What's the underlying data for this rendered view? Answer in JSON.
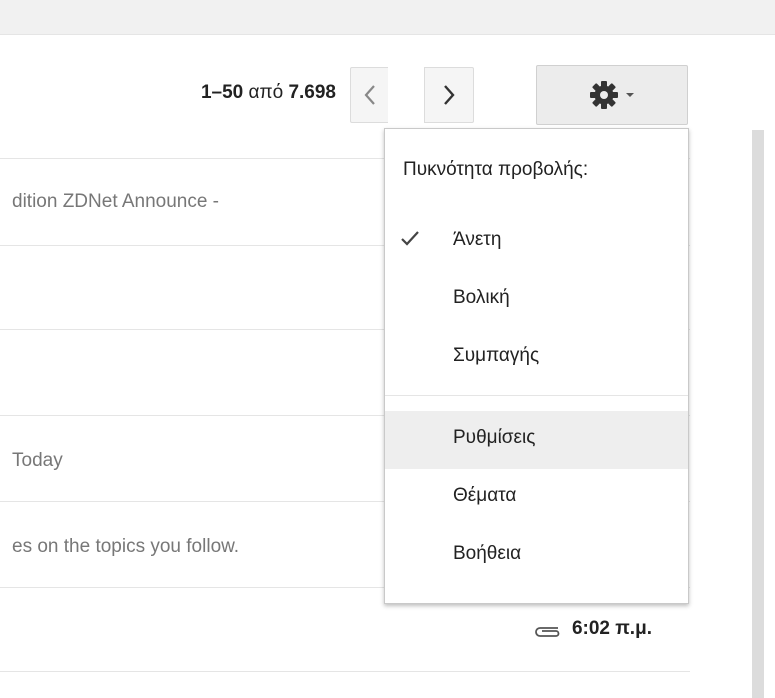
{
  "pager": {
    "range": "1–50",
    "of_word": "από",
    "total": "7.698"
  },
  "nav": {
    "prev_icon": "chevron-left-icon",
    "next_icon": "chevron-right-icon"
  },
  "settings_button": {
    "icon": "gear-icon",
    "dropdown_icon": "caret-down-icon"
  },
  "rows": [
    {
      "snippet": "dition ZDNet Announce -"
    },
    {
      "snippet": ""
    },
    {
      "snippet": ""
    },
    {
      "snippet": "Today"
    },
    {
      "snippet": "es on the topics you follow."
    },
    {
      "snippet": "",
      "time": "6:02 π.μ.",
      "attachment_icon": "paperclip-icon"
    },
    {
      "snippet": ""
    }
  ],
  "menu": {
    "density_heading": "Πυκνότητα προβολής:",
    "density_options": [
      {
        "label": "Άνετη",
        "checked": true
      },
      {
        "label": "Βολική",
        "checked": false
      },
      {
        "label": "Συμπαγής",
        "checked": false
      }
    ],
    "items": [
      {
        "label": "Ρυθμίσεις"
      },
      {
        "label": "Θέματα"
      },
      {
        "label": "Βοήθεια"
      }
    ]
  }
}
